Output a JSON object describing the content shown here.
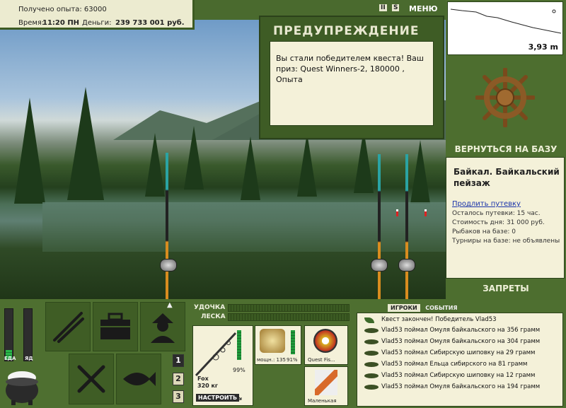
{
  "top_info": {
    "experience_label": "Получено опыта: 63000",
    "time_label": "Время:",
    "time_value": "11:20 ПН",
    "money_label": "Деньги:",
    "money_value": "239 733 001 руб."
  },
  "top_icons": {
    "pause": "II",
    "sound": "S",
    "menu": "МЕНЮ"
  },
  "warning": {
    "title": "ПРЕДУПРЕЖДЕНИЕ",
    "text": "Вы стали победителем квеста! Ваш приз: Quest Winners-2, 180000 , Опыта"
  },
  "depth": {
    "value": "3,93 m"
  },
  "right_panel": {
    "return_base": "ВЕРНУТЬСЯ НА БАЗУ",
    "base_name": "Байкал. Байкальский пейзаж",
    "extend_link": "Продлить путевку",
    "lines": [
      "Осталось путевки: 15 час.",
      "Стоимость дня: 31 000 руб.",
      "Рыбаков на базе: 0",
      "Турниры на базе: не объявлены"
    ],
    "bans": "ЗАПРЕТЫ"
  },
  "bottom_left": {
    "meter_eat": "ЕДА",
    "meter_poison": "ЯД",
    "slot_numbers": [
      "1",
      "2",
      "3"
    ],
    "selected_slot": "1"
  },
  "tackle": {
    "rod_label": "УДОЧКА",
    "line_label": "ЛЕСКА",
    "rod_percent": "99%",
    "rod_name": "Fox",
    "rod_weight": "320 кг",
    "configure": "НАСТРОИТЬ",
    "reel_power": "мощн.: 135",
    "reel_percent": "91%",
    "line_name": "Quest Fis...",
    "bait_name": "Маленькая"
  },
  "chat": {
    "tab_players": "ИГРОКИ",
    "tab_events": "СОБЫТИЯ",
    "messages": [
      "Квест закончен! Победитель Vlad53",
      "Vlad53 поймал Омуля байкальского на 356 грамм",
      "Vlad53 поймал Омуля байкальского на 304 грамм",
      "Vlad53 поймал Сибирскую шиповку на 29 грамм",
      "Vlad53 поймал Ельца сибирского на 81 грамм",
      "Vlad53 поймал Сибирскую шиповку на 12 грамм",
      "Vlad53 поймал Омуля байкальского на 194 грамм"
    ]
  },
  "colors": {
    "panel_green": "#4d6e2f",
    "dark_green": "#2b421a",
    "cream": "#f4f1d9",
    "accent_orange": "#d98c1f"
  },
  "icons": {
    "tile_1": "fishing-rods-icon",
    "tile_2": "tackle-box-icon",
    "tile_3": "fisherman-icon",
    "tile_4": "knife-fork-icon",
    "tile_5": "fish-icon",
    "ship_wheel": "ship-wheel-icon",
    "pot": "cauldron-icon"
  }
}
